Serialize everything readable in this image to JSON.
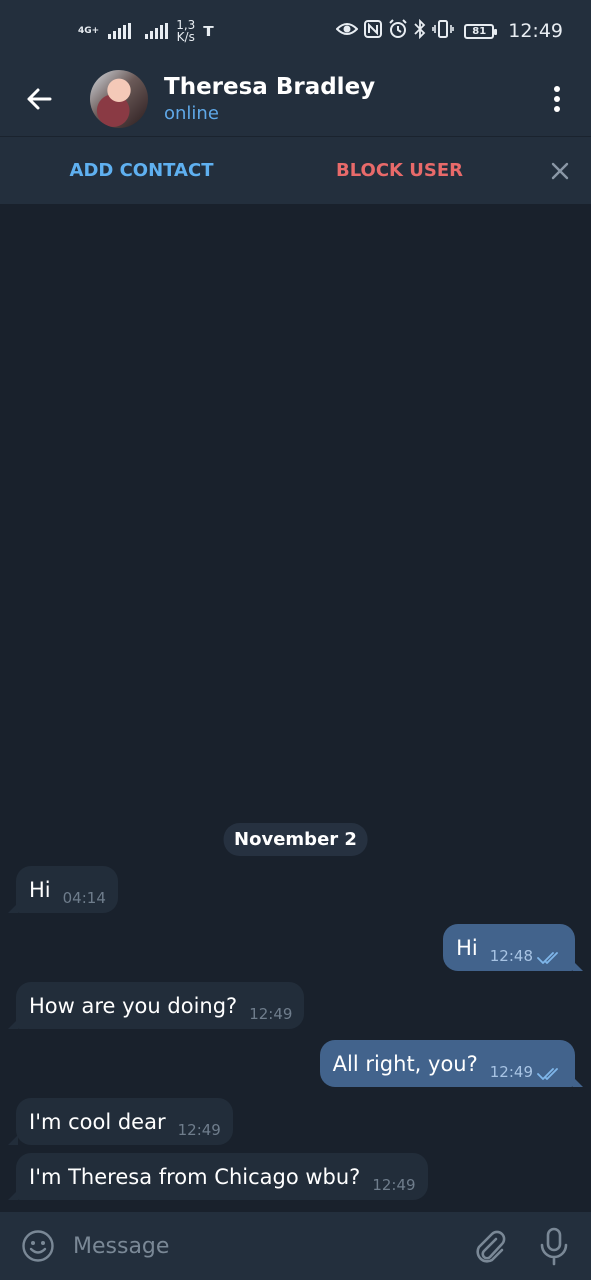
{
  "status_bar": {
    "network_type": "4G+",
    "speed_value": "1,3",
    "speed_unit": "K/s",
    "battery": "81",
    "time": "12:49",
    "icons": [
      "signal-icon",
      "signal-icon",
      "t-app-icon",
      "eye-icon",
      "nfc-icon",
      "alarm-icon",
      "bluetooth-icon",
      "vibrate-icon",
      "battery-icon"
    ]
  },
  "header": {
    "contact_name": "Theresa Bradley",
    "contact_status": "online"
  },
  "action_bar": {
    "add_contact": "ADD CONTACT",
    "block_user": "BLOCK USER"
  },
  "chat": {
    "date_label": "November 2",
    "messages": [
      {
        "direction": "in",
        "text": "Hi",
        "time": "04:14"
      },
      {
        "direction": "out",
        "text": "Hi",
        "time": "12:48",
        "read": true
      },
      {
        "direction": "in",
        "text": "How are you doing?",
        "time": "12:49"
      },
      {
        "direction": "out",
        "text": "All right, you?",
        "time": "12:49",
        "read": true
      },
      {
        "direction": "in",
        "text": "I'm cool dear",
        "time": "12:49"
      },
      {
        "direction": "in",
        "text": "I'm Theresa from Chicago wbu?",
        "time": "12:49"
      }
    ]
  },
  "input_bar": {
    "placeholder": "Message"
  },
  "colors": {
    "background": "#19212c",
    "bar": "#232f3d",
    "incoming_bubble": "#222d3a",
    "outgoing_bubble": "#42638c",
    "accent": "#5fb0f0",
    "danger": "#e86a6a"
  }
}
